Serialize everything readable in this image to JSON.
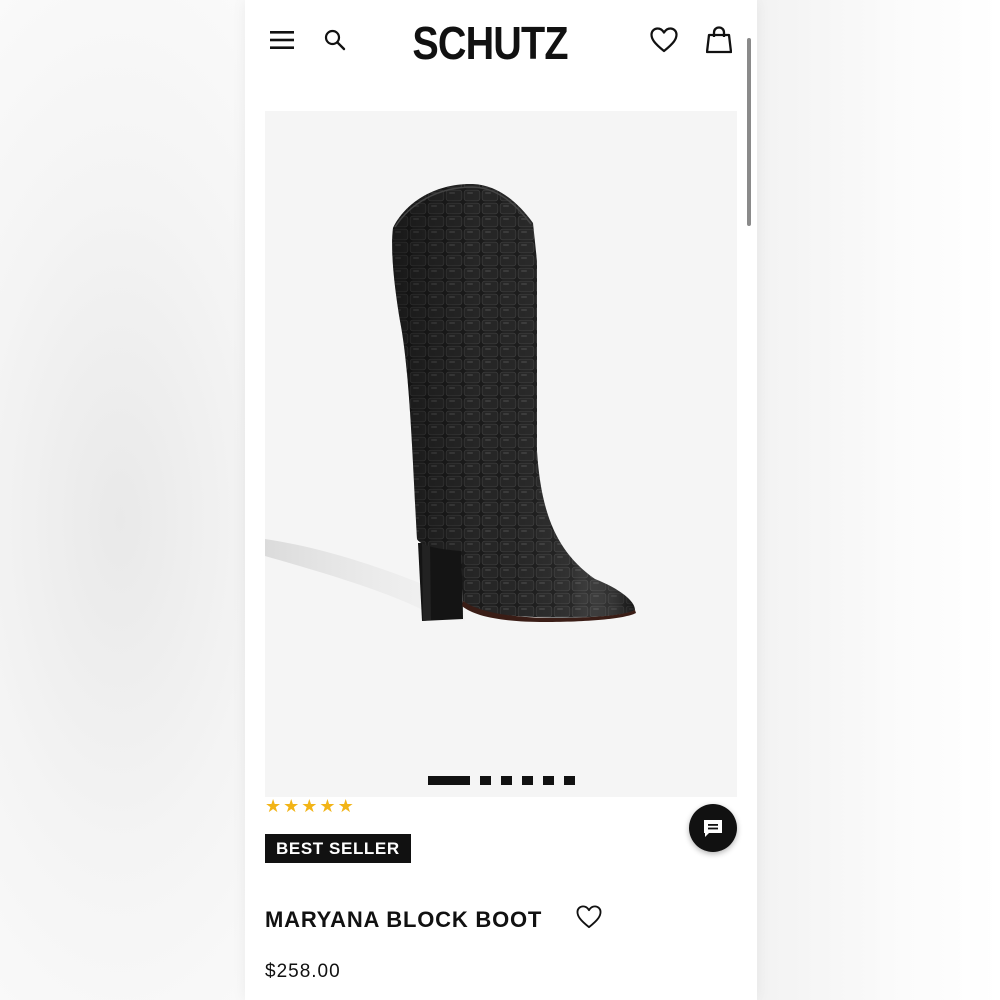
{
  "brand": {
    "logo_text": "SCHUTZ"
  },
  "header": {
    "menu_icon": "hamburger-menu-icon",
    "search_icon": "search-icon",
    "wishlist_icon": "heart-outline-icon",
    "bag_icon": "shopping-bag-icon"
  },
  "gallery": {
    "slide_count": 6,
    "active_slide": 1,
    "image_description_icon": "product-photo"
  },
  "product": {
    "rating_stars": 5,
    "rating_max": 5,
    "badge": "BEST SELLER",
    "name": "MARYANA BLOCK BOOT",
    "price": "$258.00"
  },
  "chat": {
    "icon": "chat-bubble-icon"
  },
  "colors": {
    "text": "#111111",
    "star": "#f2b417",
    "image_bg": "#f5f5f5",
    "badge_bg": "#111111",
    "badge_text": "#ffffff"
  }
}
